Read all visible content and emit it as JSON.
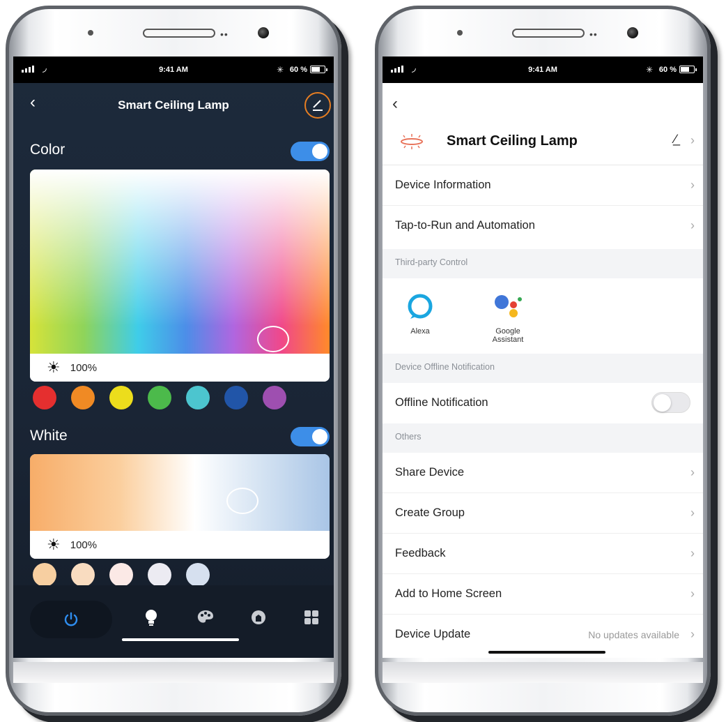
{
  "status_bar": {
    "time": "9:41 AM",
    "bluetooth_icon": "bluetooth-icon",
    "battery_text": "60 %",
    "battery_level": 0.6
  },
  "control_screen": {
    "title": "Smart Ceiling Lamp",
    "back_icon": "chevron-left-icon",
    "edit_icon": "edit-pencil-icon",
    "color_section": {
      "label": "Color",
      "enabled": true,
      "brightness": "100%",
      "swatches": [
        "#e52f2f",
        "#f08a24",
        "#ecdd1c",
        "#4cba4b",
        "#4cc5cf",
        "#2155a8",
        "#9e4fb0"
      ]
    },
    "white_section": {
      "label": "White",
      "enabled": true,
      "brightness": "100%",
      "swatches": [
        "#f7cfa1",
        "#f9dcc0",
        "#fbe9e6",
        "#ecebf2",
        "#d6e0ef"
      ]
    },
    "tabs": [
      {
        "icon": "power-icon",
        "active": true
      },
      {
        "icon": "bulb-icon",
        "active": false
      },
      {
        "icon": "palette-icon",
        "active": false
      },
      {
        "icon": "scene-icon",
        "active": false
      },
      {
        "icon": "grid-icon",
        "active": false
      }
    ]
  },
  "settings_screen": {
    "device_name": "Smart Ceiling Lamp",
    "back_icon": "chevron-left-icon",
    "device_icon": "ceiling-lamp-icon",
    "rows_top": [
      {
        "label": "Device Information"
      },
      {
        "label": "Tap-to-Run and Automation"
      }
    ],
    "third_party": {
      "header": "Third-party Control",
      "items": [
        {
          "name": "Alexa",
          "icon": "alexa-icon"
        },
        {
          "name": "Google\nAssistant",
          "icon": "google-assistant-icon"
        }
      ]
    },
    "offline": {
      "header": "Device Offline Notification",
      "label": "Offline Notification",
      "enabled": false
    },
    "others": {
      "header": "Others",
      "rows": [
        {
          "label": "Share Device"
        },
        {
          "label": "Create Group"
        },
        {
          "label": "Feedback"
        },
        {
          "label": "Add to Home Screen"
        },
        {
          "label": "Device Update",
          "value": "No updates available"
        }
      ]
    }
  }
}
